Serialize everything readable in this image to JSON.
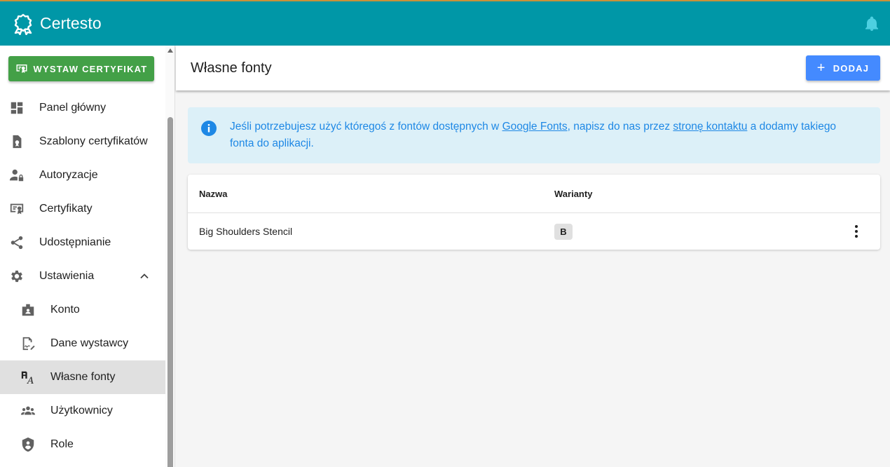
{
  "app": {
    "name": "Certesto",
    "colors": {
      "appbar": "#0097a7",
      "issue_button": "#43a047",
      "add_button": "#448aff",
      "info": "#1e88e5"
    }
  },
  "sidebar": {
    "issue_button_label": "WYSTAW CERTYFIKAT",
    "items": [
      {
        "label": "Panel główny",
        "icon": "dashboard-icon"
      },
      {
        "label": "Szablony certyfikatów",
        "icon": "certificate-template-icon"
      },
      {
        "label": "Autoryzacje",
        "icon": "user-lock-icon"
      },
      {
        "label": "Certyfikaty",
        "icon": "certificate-icon"
      },
      {
        "label": "Udostępnianie",
        "icon": "share-icon"
      },
      {
        "label": "Ustawienia",
        "icon": "gear-icon",
        "expanded": true
      }
    ],
    "sub_items": [
      {
        "label": "Konto",
        "icon": "badge-icon"
      },
      {
        "label": "Dane wystawcy",
        "icon": "signature-icon"
      },
      {
        "label": "Własne fonty",
        "icon": "font-icon",
        "active": true
      },
      {
        "label": "Użytkownicy",
        "icon": "users-icon"
      },
      {
        "label": "Role",
        "icon": "shield-user-icon"
      }
    ]
  },
  "page": {
    "title": "Własne fonty",
    "add_label": "DODAJ"
  },
  "alert": {
    "part1": "Jeśli potrzebujesz użyć któregoś z fontów dostępnych w ",
    "link1": "Google Fonts",
    "part2": ", napisz do nas przez ",
    "link2": "stronę kontaktu",
    "part3": " a dodamy takiego fonta do aplikacji."
  },
  "table": {
    "headers": {
      "name": "Nazwa",
      "variants": "Warianty"
    },
    "rows": [
      {
        "name": "Big Shoulders Stencil",
        "variants": [
          "B"
        ]
      }
    ]
  }
}
